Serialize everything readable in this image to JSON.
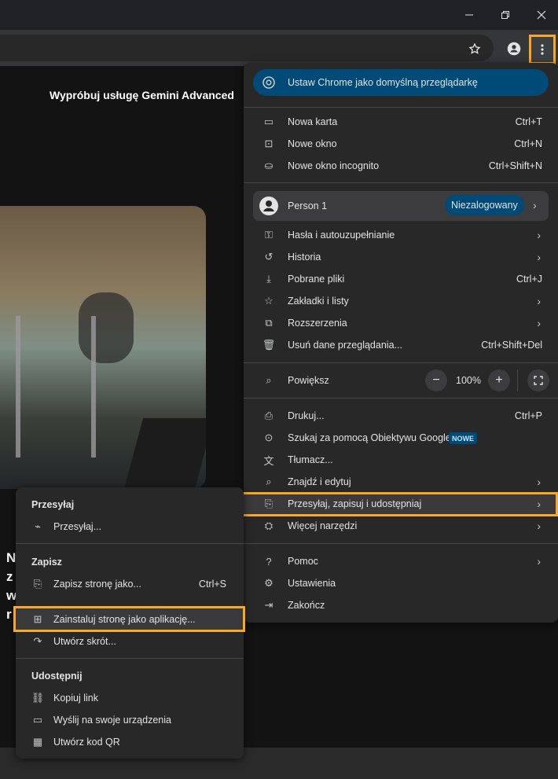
{
  "window": {
    "minimize_icon": "minimize-icon",
    "maximize_icon": "restore-icon",
    "close_icon": "close-icon"
  },
  "toolbar": {
    "bookmark_icon": "star-icon",
    "profile_icon": "person-icon",
    "menu_icon": "vertical-dots-icon"
  },
  "page": {
    "promo_text": "Wypróbuj usługę Gemini Advanced",
    "left_peek_letters": [
      "N",
      "z",
      "w",
      "r"
    ]
  },
  "menu": {
    "default_browser": "Ustaw Chrome jako domyślną przeglądarkę",
    "group1": [
      {
        "label": "Nowa karta",
        "shortcut": "Ctrl+T",
        "icon": "new-tab-icon"
      },
      {
        "label": "Nowe okno",
        "shortcut": "Ctrl+N",
        "icon": "new-window-icon"
      },
      {
        "label": "Nowe okno incognito",
        "shortcut": "Ctrl+Shift+N",
        "icon": "incognito-icon"
      }
    ],
    "person": {
      "name": "Person 1",
      "status": "Niezalogowany"
    },
    "group2": [
      {
        "label": "Hasła i autouzupełnianie",
        "shortcut": "",
        "icon": "key-icon",
        "submenu": true
      },
      {
        "label": "Historia",
        "shortcut": "",
        "icon": "history-icon",
        "submenu": true
      },
      {
        "label": "Pobrane pliki",
        "shortcut": "Ctrl+J",
        "icon": "download-icon",
        "submenu": false
      },
      {
        "label": "Zakładki i listy",
        "shortcut": "",
        "icon": "star-icon",
        "submenu": true
      },
      {
        "label": "Rozszerzenia",
        "shortcut": "",
        "icon": "puzzle-icon",
        "submenu": true
      },
      {
        "label": "Usuń dane przeglądania...",
        "shortcut": "Ctrl+Shift+Del",
        "icon": "trash-icon",
        "submenu": false
      }
    ],
    "zoom": {
      "label": "Powiększ",
      "value": "100%",
      "minus": "−",
      "plus": "+"
    },
    "group3": [
      {
        "label": "Drukuj...",
        "shortcut": "Ctrl+P",
        "icon": "print-icon",
        "submenu": false
      },
      {
        "label": "Szukaj za pomocą Obiektywu Google",
        "shortcut": "",
        "icon": "lens-icon",
        "submenu": false,
        "badge": "NOWE"
      },
      {
        "label": "Tłumacz...",
        "shortcut": "",
        "icon": "translate-icon",
        "submenu": false
      },
      {
        "label": "Znajdź i edytuj",
        "shortcut": "",
        "icon": "find-icon",
        "submenu": true
      },
      {
        "label": "Przesyłaj, zapisuj i udostępniaj",
        "shortcut": "",
        "icon": "save-share-icon",
        "submenu": true
      },
      {
        "label": "Więcej narzędzi",
        "shortcut": "",
        "icon": "toolbox-icon",
        "submenu": true
      }
    ],
    "group4": [
      {
        "label": "Pomoc",
        "shortcut": "",
        "icon": "help-icon",
        "submenu": true
      },
      {
        "label": "Ustawienia",
        "shortcut": "",
        "icon": "gear-icon",
        "submenu": false
      },
      {
        "label": "Zakończ",
        "shortcut": "",
        "icon": "exit-icon",
        "submenu": false
      }
    ]
  },
  "submenu": {
    "cast_heading": "Przesyłaj",
    "cast_item": {
      "label": "Przesyłaj...",
      "icon": "cast-icon"
    },
    "save_heading": "Zapisz",
    "save_items": [
      {
        "label": "Zapisz stronę jako...",
        "shortcut": "Ctrl+S",
        "icon": "save-page-icon"
      },
      {
        "label": "Zainstaluj stronę jako aplikację...",
        "shortcut": "",
        "icon": "install-app-icon"
      },
      {
        "label": "Utwórz skrót...",
        "shortcut": "",
        "icon": "shortcut-icon"
      }
    ],
    "share_heading": "Udostępnij",
    "share_items": [
      {
        "label": "Kopiuj link",
        "icon": "link-icon"
      },
      {
        "label": "Wyślij na swoje urządzenia",
        "icon": "devices-icon"
      },
      {
        "label": "Utwórz kod QR",
        "icon": "qr-code-icon"
      }
    ]
  }
}
